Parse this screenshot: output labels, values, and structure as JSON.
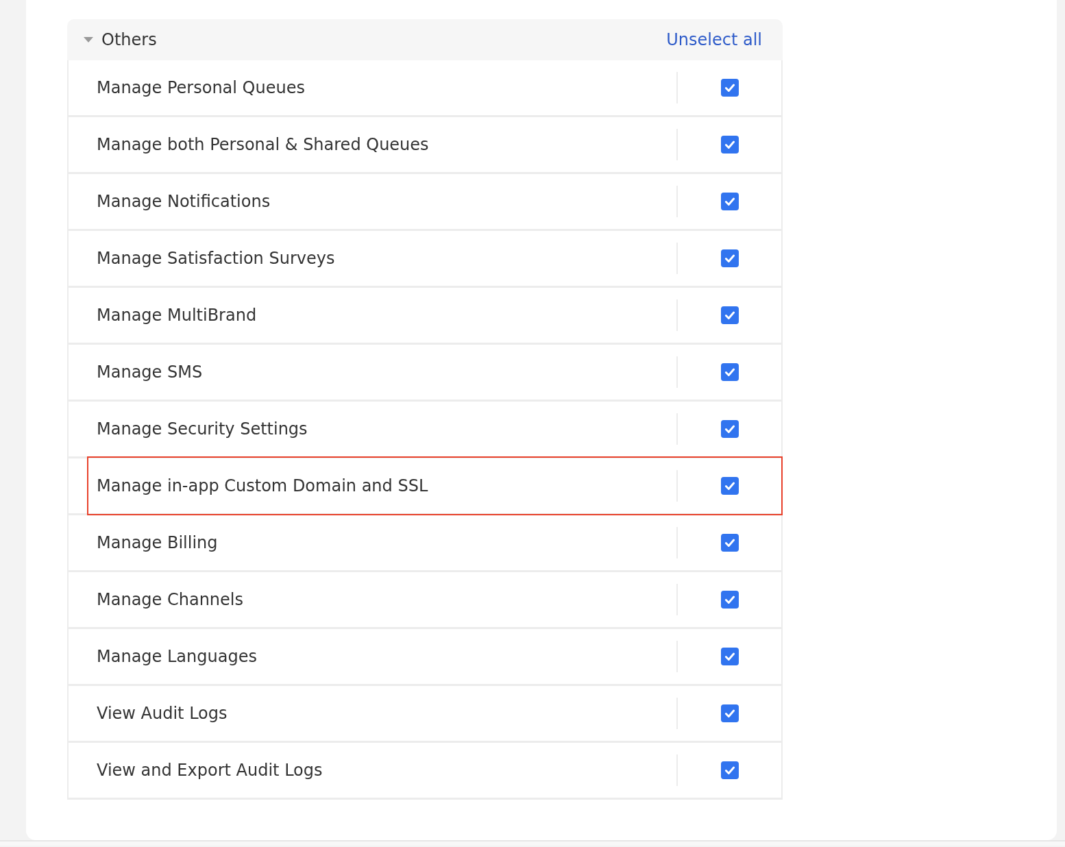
{
  "section": {
    "title": "Others",
    "expanded": true,
    "action": "Unselect all"
  },
  "permissions": [
    {
      "label": "Manage Personal Queues",
      "checked": true,
      "highlighted": false
    },
    {
      "label": "Manage both Personal & Shared Queues",
      "checked": true,
      "highlighted": false
    },
    {
      "label": "Manage Notifications",
      "checked": true,
      "highlighted": false
    },
    {
      "label": "Manage Satisfaction Surveys",
      "checked": true,
      "highlighted": false
    },
    {
      "label": "Manage MultiBrand",
      "checked": true,
      "highlighted": false
    },
    {
      "label": "Manage SMS",
      "checked": true,
      "highlighted": false
    },
    {
      "label": "Manage Security Settings",
      "checked": true,
      "highlighted": false
    },
    {
      "label": "Manage in-app Custom Domain and SSL",
      "checked": true,
      "highlighted": true
    },
    {
      "label": "Manage Billing",
      "checked": true,
      "highlighted": false
    },
    {
      "label": "Manage Channels",
      "checked": true,
      "highlighted": false
    },
    {
      "label": "Manage Languages",
      "checked": true,
      "highlighted": false
    },
    {
      "label": "View Audit Logs",
      "checked": true,
      "highlighted": false
    },
    {
      "label": "View and Export Audit Logs",
      "checked": true,
      "highlighted": false
    }
  ]
}
